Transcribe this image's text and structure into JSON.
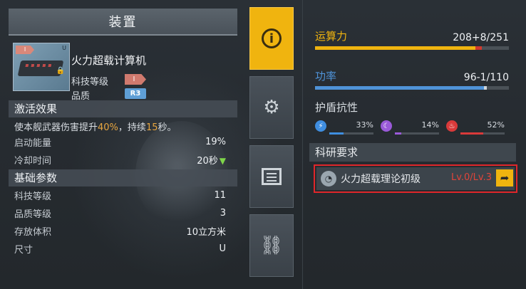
{
  "header": {
    "title": "装置"
  },
  "item": {
    "name": "火力超载计算机",
    "tech_label": "科技等级",
    "tech_badge": "I",
    "quality_label": "品质",
    "quality_badge": "R3",
    "thumb_badge": "I",
    "thumb_size": "U"
  },
  "activation": {
    "title": "激活效果",
    "desc_pre": "使本舰武器伤害提升",
    "desc_pct": "40%",
    "desc_mid": "，持续",
    "desc_dur": "15",
    "desc_post": "秒。",
    "rows": [
      {
        "label": "启动能量",
        "value": "19%"
      },
      {
        "label": "冷却时间",
        "value": "20秒"
      }
    ]
  },
  "basic": {
    "title": "基础参数",
    "rows": [
      {
        "label": "科技等级",
        "value": "11"
      },
      {
        "label": "品质等级",
        "value": "3"
      },
      {
        "label": "存放体积",
        "value": "10立方米"
      },
      {
        "label": "尺寸",
        "value": "U"
      }
    ]
  },
  "tabs": [
    {
      "name": "info",
      "icon": "info-icon",
      "glyph": "i",
      "active": true
    },
    {
      "name": "modules",
      "icon": "wrench-gear-icon",
      "active": false
    },
    {
      "name": "list",
      "icon": "list-icon",
      "active": false
    },
    {
      "name": "network",
      "icon": "network-icon",
      "active": false
    }
  ],
  "stats": {
    "compute": {
      "label": "运算力",
      "value": "208+8/251",
      "fraction": 0.829,
      "extra_fraction": 0.032,
      "color": "#f0b40f"
    },
    "power": {
      "label": "功率",
      "value": "96-1/110",
      "fraction": 0.873,
      "color": "#4f93d8"
    },
    "shield": {
      "title": "护盾抗性",
      "items": [
        {
          "icon": "lightning-icon",
          "glyph": "⚡",
          "pct": "33%",
          "fraction": 0.33,
          "color": "#3f8ee0"
        },
        {
          "icon": "crescent-icon",
          "glyph": "☾",
          "pct": "14%",
          "fraction": 0.14,
          "color": "#9a5ad8"
        },
        {
          "icon": "flame-icon",
          "glyph": "♨",
          "pct": "52%",
          "fraction": 0.52,
          "color": "#d93a3a"
        }
      ]
    }
  },
  "research": {
    "title": "科研要求",
    "item_name": "火力超载理论初级",
    "level": "Lv.0/Lv.3",
    "go_glyph": "➦"
  }
}
